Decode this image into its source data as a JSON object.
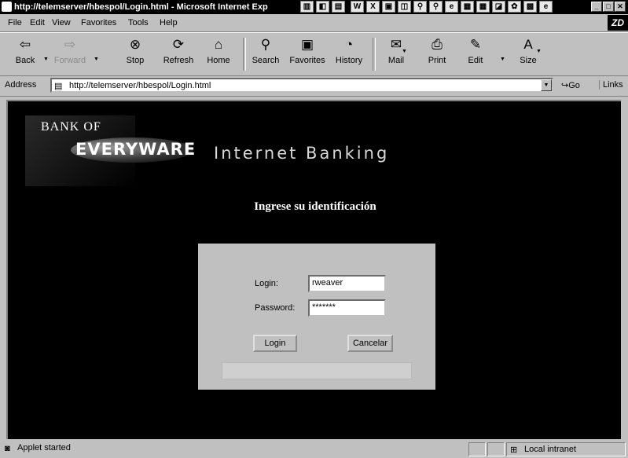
{
  "window": {
    "title": "http://telemserver/hbespol/Login.html - Microsoft Internet Exp",
    "buttons": {
      "minimize": "_",
      "maximize": "□",
      "close": "✕"
    }
  },
  "menu": [
    "File",
    "Edit",
    "View",
    "Favorites",
    "Tools",
    "Help"
  ],
  "brand_badge": "ZD",
  "toolbar": {
    "back": "Back",
    "forward": "Forward",
    "stop": "Stop",
    "refresh": "Refresh",
    "home": "Home",
    "search": "Search",
    "favorites": "Favorites",
    "history": "History",
    "mail": "Mail",
    "print": "Print",
    "edit": "Edit",
    "size": "Size"
  },
  "address": {
    "label": "Address",
    "url": "http://telemserver/hbespol/Login.html",
    "go": "Go",
    "links": "Links"
  },
  "page": {
    "logo_top": "BANK OF",
    "logo_word": "EVERYWARE",
    "product": "Internet Banking",
    "heading": "Ingrese su identificación",
    "login_label": "Login:",
    "login_value": "rweaver",
    "password_label": "Password:",
    "password_value": "*******",
    "login_button": "Login",
    "cancel_button": "Cancelar"
  },
  "status": {
    "text": "Applet started",
    "zone": "Local intranet"
  },
  "icons": {
    "back": "left-arrow-icon",
    "forward": "right-arrow-icon",
    "stop": "stop-icon",
    "refresh": "refresh-icon",
    "home": "home-icon",
    "search": "search-icon",
    "favorites": "favorites-icon",
    "history": "history-icon",
    "mail": "mail-icon",
    "print": "print-icon",
    "edit": "edit-icon",
    "size": "size-icon"
  }
}
